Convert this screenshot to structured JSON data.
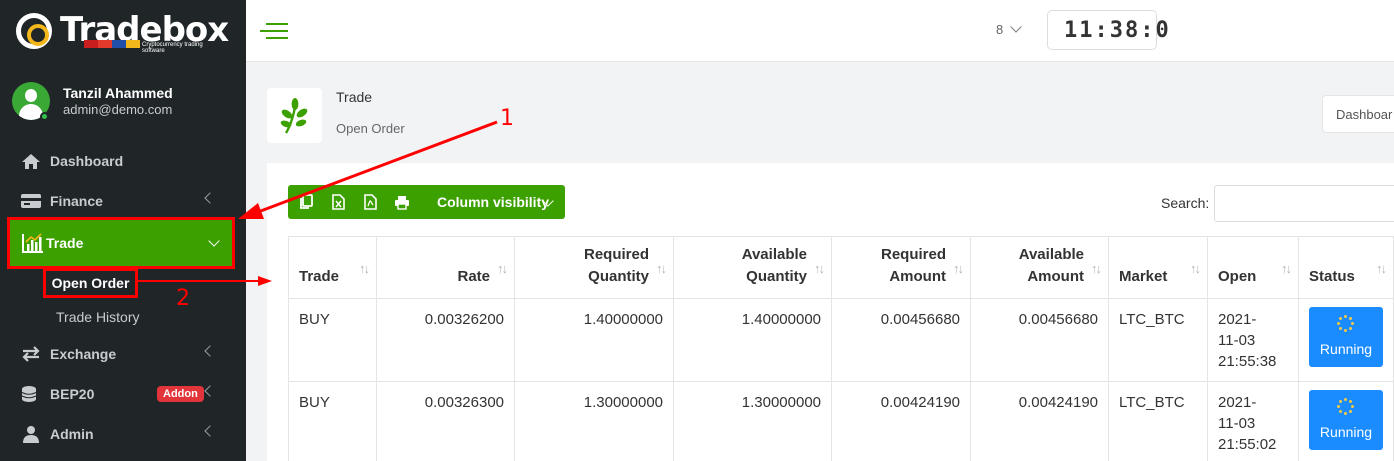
{
  "brand": {
    "name": "Tradebox",
    "tagline": "Cryptocurrency trading software",
    "bar_colors": [
      "#c81e1e",
      "#e23b2c",
      "#1f4fa8",
      "#f3b71c"
    ]
  },
  "user": {
    "name": "Tanzil Ahammed",
    "email": "admin@demo.com"
  },
  "sidebar": {
    "items": [
      {
        "label": "Dashboard",
        "icon": "home-icon"
      },
      {
        "label": "Finance",
        "icon": "wallet-icon"
      },
      {
        "label": "Trade",
        "icon": "chart-icon",
        "active": true
      },
      {
        "label": "Exchange",
        "icon": "exchange-icon"
      },
      {
        "label": "BEP20",
        "icon": "coins-icon",
        "badge": "Addon"
      },
      {
        "label": "Admin",
        "icon": "user-icon"
      }
    ],
    "trade_sub": [
      {
        "label": "Open Order",
        "active": true
      },
      {
        "label": "Trade History"
      }
    ]
  },
  "header": {
    "lang": "8",
    "clock": "11:38:0"
  },
  "page": {
    "title": "Trade",
    "subtitle": "Open Order",
    "breadcrumb_btn": "Dashboar"
  },
  "toolbar": {
    "column_visibility": "Column visibility",
    "search_label": "Search:"
  },
  "table": {
    "headers": [
      [
        "Trade"
      ],
      [
        "Rate"
      ],
      [
        "Required",
        "Quantity"
      ],
      [
        "Available",
        "Quantity"
      ],
      [
        "Required",
        "Amount"
      ],
      [
        "Available",
        "Amount"
      ],
      [
        "Market"
      ],
      [
        "Open"
      ],
      [
        "Status"
      ]
    ],
    "rows": [
      {
        "trade": "BUY",
        "rate": "0.00326200",
        "req_qty": "1.40000000",
        "avail_qty": "1.40000000",
        "req_amt": "0.00456680",
        "avail_amt": "0.00456680",
        "market": "LTC_BTC",
        "open": [
          "2021-",
          "11-03",
          "21:55:38"
        ],
        "status": "Running"
      },
      {
        "trade": "BUY",
        "rate": "0.00326300",
        "req_qty": "1.30000000",
        "avail_qty": "1.30000000",
        "req_amt": "0.00424190",
        "avail_amt": "0.00424190",
        "market": "LTC_BTC",
        "open": [
          "2021-",
          "11-03",
          "21:55:02"
        ],
        "status": "Running"
      }
    ]
  },
  "annotations": {
    "one": "1",
    "two": "2",
    "color": "#ff0000"
  },
  "colors": {
    "accent": "#3ca000",
    "status": "#1a8cff",
    "sidebar_bg": "#202528"
  }
}
